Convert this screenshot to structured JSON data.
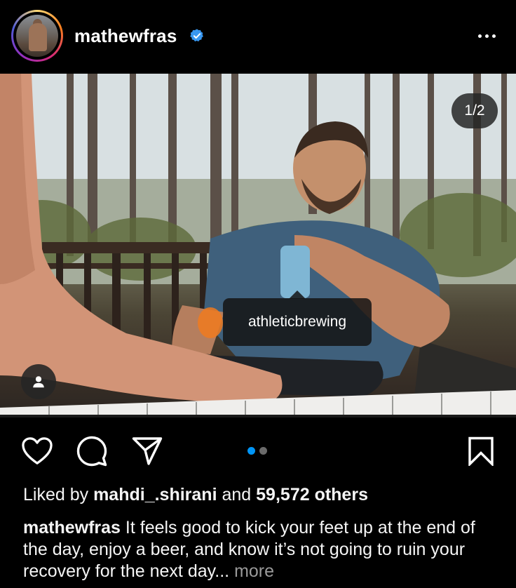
{
  "post": {
    "username": "mathewfras",
    "verified": true,
    "photo_counter": "1/2",
    "tagged_account": "athleticbrewing",
    "carousel": {
      "total": 2,
      "active": 1
    },
    "likes": {
      "prefix": "Liked by",
      "first_user": "mahdi_.shirani",
      "joiner": "and",
      "others": "59,572 others"
    },
    "caption": {
      "author": "mathewfras",
      "text": "It feels good to kick your feet up at the end of the day, enjoy a beer, and know it’s not going to ruin your recovery for the next day...",
      "more_label": "more"
    }
  },
  "icons": {
    "verified": "verified-badge-icon",
    "options": "more-options-icon",
    "tagged_people": "user-tag-icon",
    "like": "heart-icon",
    "comment": "comment-bubble-icon",
    "share": "send-paper-plane-icon",
    "save": "bookmark-icon"
  },
  "colors": {
    "background": "#000000",
    "verified_blue": "#3897f0",
    "active_dot": "#0095f6",
    "inactive_dot": "#6b6b6b",
    "muted_text": "#9a9a9a"
  }
}
